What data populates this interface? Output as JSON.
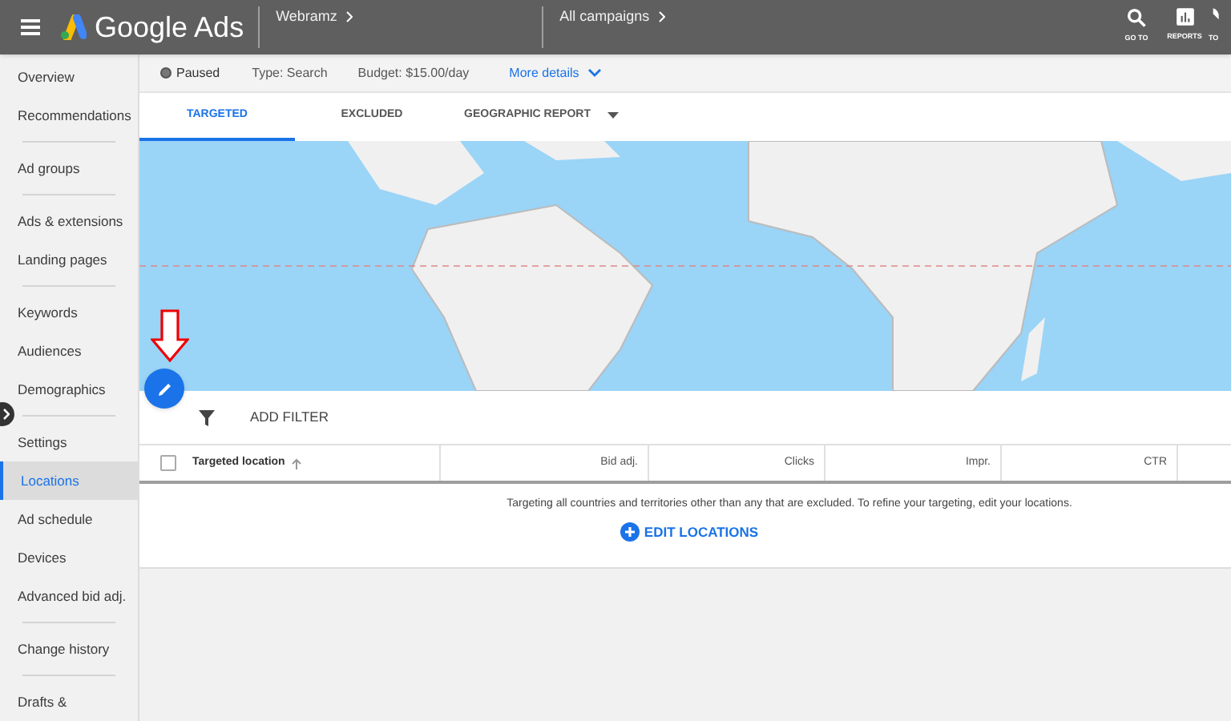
{
  "app_bar": {
    "product": "Google Ads",
    "account": "Webramz",
    "campaign": "All campaigns",
    "actions": [
      {
        "label": "GO TO",
        "kind": "search"
      },
      {
        "label": "REPORTS",
        "kind": "reports"
      },
      {
        "label": "TO",
        "kind": "tools"
      }
    ]
  },
  "sidebar": {
    "groups": [
      [
        {
          "label": "Overview",
          "selected": false
        },
        {
          "label": "Recommendations",
          "selected": false
        }
      ],
      [
        {
          "label": "Ad groups",
          "selected": false
        }
      ],
      [
        {
          "label": "Ads & extensions",
          "selected": false
        },
        {
          "label": "Landing pages",
          "selected": false
        }
      ],
      [
        {
          "label": "Keywords",
          "selected": false
        },
        {
          "label": "Audiences",
          "selected": false
        },
        {
          "label": "Demographics",
          "selected": false
        }
      ],
      [
        {
          "label": "Settings",
          "selected": false
        },
        {
          "label": "Locations",
          "selected": true
        },
        {
          "label": "Ad schedule",
          "selected": false
        },
        {
          "label": "Devices",
          "selected": false
        },
        {
          "label": "Advanced bid adj.",
          "selected": false
        }
      ],
      [
        {
          "label": "Change history",
          "selected": false
        }
      ],
      [
        {
          "label": "Drafts &",
          "selected": false
        }
      ]
    ]
  },
  "summary": {
    "status": "Paused",
    "type": "Type: Search",
    "budget": "Budget: $15.00/day",
    "more": "More details"
  },
  "tabs": [
    {
      "label": "TARGETED",
      "selected": true
    },
    {
      "label": "EXCLUDED",
      "selected": false
    },
    {
      "label": "GEOGRAPHIC REPORT",
      "selected": false,
      "dropdown": true
    }
  ],
  "filter": {
    "label": "ADD FILTER"
  },
  "table": {
    "select_all": {
      "checked": false
    },
    "columns": [
      {
        "label": "Targeted location",
        "sorted": true
      },
      {
        "label": "Bid adj.",
        "sorted": false
      },
      {
        "label": "Clicks",
        "sorted": false
      },
      {
        "label": "Impr.",
        "sorted": false
      },
      {
        "label": "CTR",
        "sorted": false
      }
    ],
    "message": "Targeting all countries and territories other than any that are excluded. To refine your targeting, edit your locations.",
    "action": "EDIT LOCATIONS"
  }
}
